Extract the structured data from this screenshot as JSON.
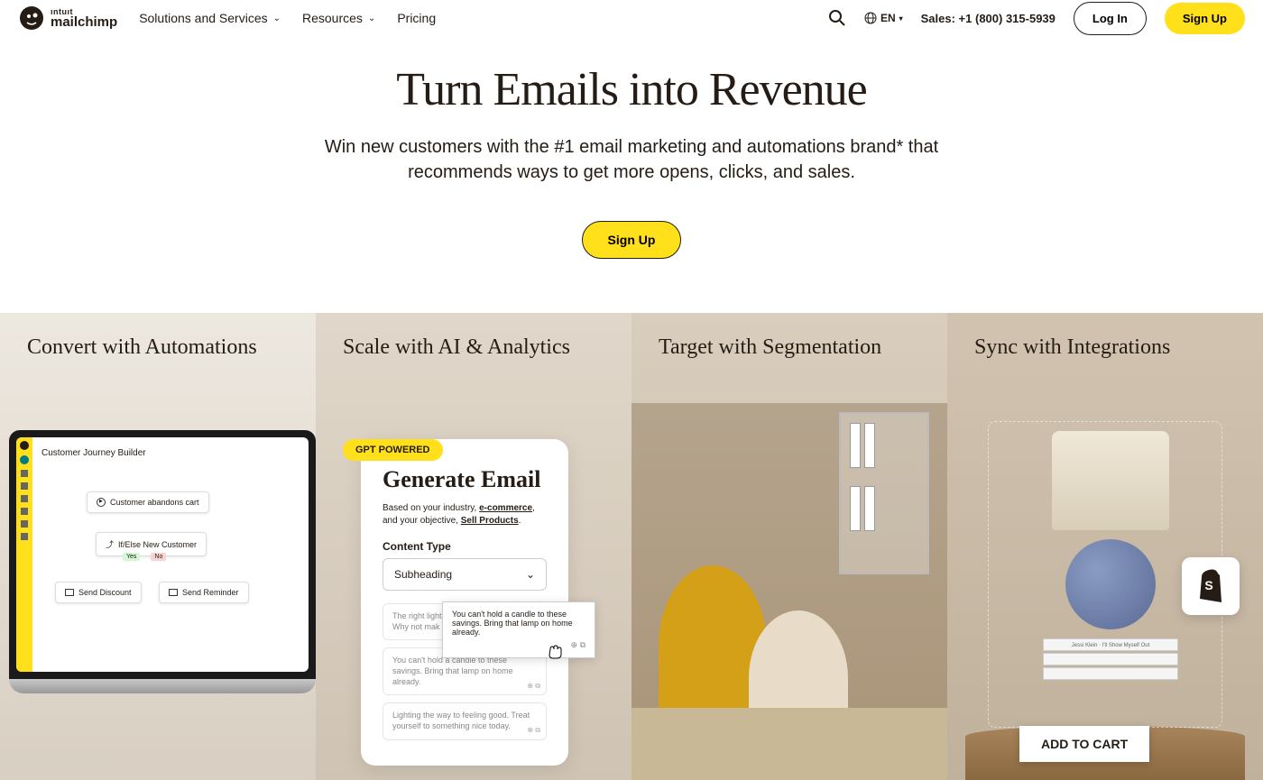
{
  "header": {
    "brand_top": "ıntuıt",
    "brand_bottom": "mailchimp",
    "nav": [
      {
        "label": "Solutions and Services"
      },
      {
        "label": "Resources"
      },
      {
        "label": "Pricing"
      }
    ],
    "lang": "EN",
    "sales": "Sales: +1 (800) 315-5939",
    "login": "Log In",
    "signup": "Sign Up"
  },
  "hero": {
    "title": "Turn Emails into Revenue",
    "subtitle": "Win new customers with the #1 email marketing and automations brand* that recommends ways to get more opens, clicks, and sales.",
    "cta": "Sign Up"
  },
  "features": {
    "f1": {
      "title": "Convert with Automations",
      "journey_title": "Customer Journey Builder",
      "node1": "Customer abandons cart",
      "node2": "If/Else New Customer",
      "yes": "Yes",
      "no": "No",
      "node3": "Send Discount",
      "node4": "Send Reminder"
    },
    "f2": {
      "title": "Scale with AI & Analytics",
      "badge": "GPT POWERED",
      "card_title": "Generate Email",
      "card_desc_1": "Based on your industry, ",
      "card_desc_link1": "e-commerce",
      "card_desc_2": ", and your objective, ",
      "card_desc_link2": "Sell Products",
      "card_desc_3": ".",
      "content_type_label": "Content Type",
      "select_value": "Subheading",
      "option1": "The right light really makes a difference. Why not mak",
      "option2": "You can't hold a candle to these savings. Bring that lamp on home already.",
      "option3": "Lighting the way to feeling good. Treat yourself to something nice today.",
      "tooltip": "You can't hold a candle to these savings. Bring that lamp on home already."
    },
    "f3": {
      "title": "Target with Segmentation"
    },
    "f4": {
      "title": "Sync with Integrations",
      "book1": "Jessi Klein · I'll Show Myself Out",
      "book2": "",
      "add_to_cart": "ADD TO CART"
    }
  }
}
